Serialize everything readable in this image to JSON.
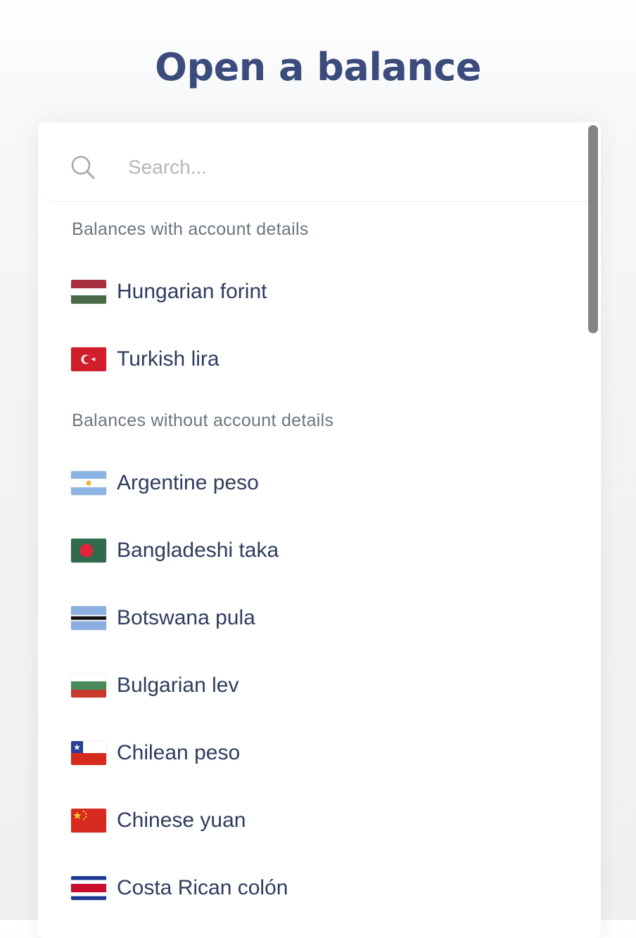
{
  "page": {
    "title": "Open a balance"
  },
  "search": {
    "placeholder": "Search...",
    "value": "",
    "icon": "search-icon"
  },
  "sections": [
    {
      "label": "Balances with account details",
      "items": [
        {
          "name": "Hungarian forint",
          "flag": "hungary-flag-icon"
        },
        {
          "name": "Turkish lira",
          "flag": "turkey-flag-icon"
        }
      ]
    },
    {
      "label": "Balances without account details",
      "items": [
        {
          "name": "Argentine peso",
          "flag": "argentina-flag-icon"
        },
        {
          "name": "Bangladeshi taka",
          "flag": "bangladesh-flag-icon"
        },
        {
          "name": "Botswana pula",
          "flag": "botswana-flag-icon"
        },
        {
          "name": "Bulgarian lev",
          "flag": "bulgaria-flag-icon"
        },
        {
          "name": "Chilean peso",
          "flag": "chile-flag-icon"
        },
        {
          "name": "Chinese yuan",
          "flag": "china-flag-icon"
        },
        {
          "name": "Costa Rican colón",
          "flag": "costa-rica-flag-icon"
        }
      ]
    }
  ],
  "colors": {
    "title": "#3b4c7c",
    "item_text": "#2e3c5e",
    "section_label": "#6b7580",
    "scrollbar_thumb": "#848484"
  }
}
